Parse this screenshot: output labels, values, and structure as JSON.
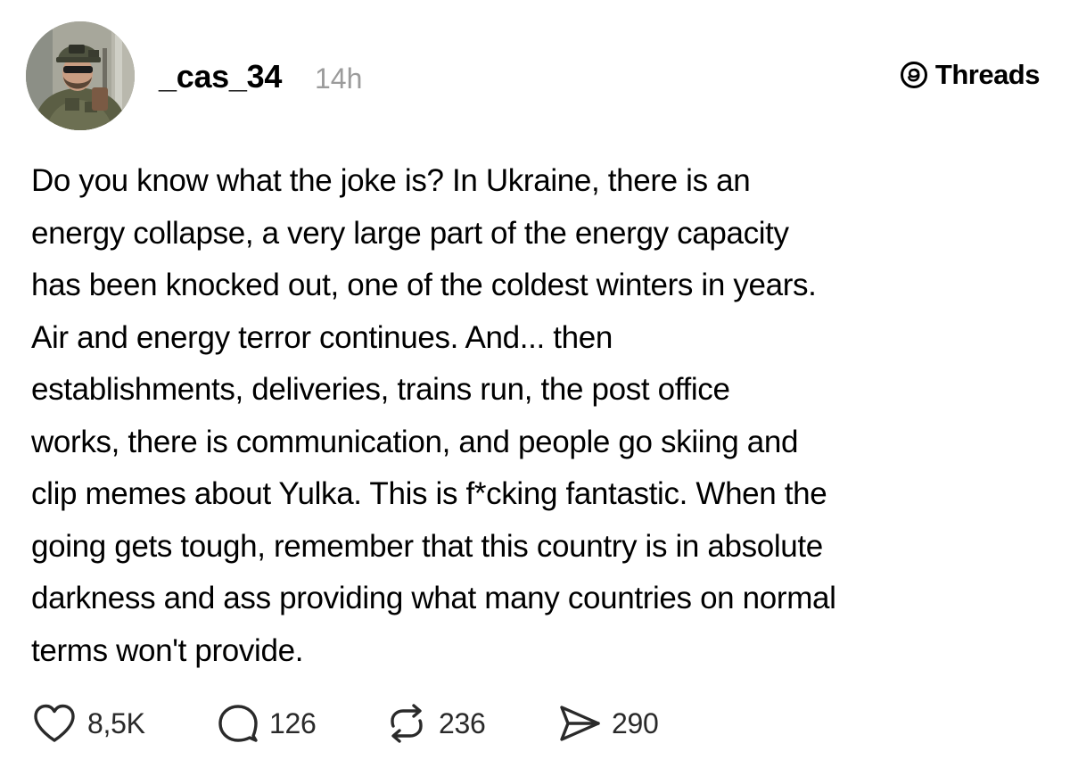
{
  "post": {
    "author": {
      "username": "_cas_34",
      "timestamp": "14h",
      "avatar_icon": "profile-photo"
    },
    "brand": {
      "label": "Threads",
      "icon": "threads-logo-icon"
    },
    "body_lines": [
      "Do you know what the joke is? In Ukraine, there is an",
      "energy collapse, a very large part of the energy capacity",
      "has been knocked out, one of the coldest winters in years.",
      "Air and energy terror continues. And... then",
      "establishments, deliveries, trains run, the post office",
      "works, there is communication, and people go skiing and",
      "clip memes about Yulka. This is f*cking fantastic. When the",
      "going gets tough, remember that this country is in absolute",
      "darkness and ass providing what many countries on normal",
      "terms won't provide."
    ],
    "actions": {
      "likes": {
        "icon": "heart-icon",
        "count": "8,5K"
      },
      "replies": {
        "icon": "comment-icon",
        "count": "126"
      },
      "reposts": {
        "icon": "repost-icon",
        "count": "236"
      },
      "shares": {
        "icon": "send-icon",
        "count": "290"
      }
    },
    "colors": {
      "text": "#000000",
      "muted": "#9b9b9b",
      "icon": "#2a2a2a",
      "background": "#ffffff"
    }
  }
}
